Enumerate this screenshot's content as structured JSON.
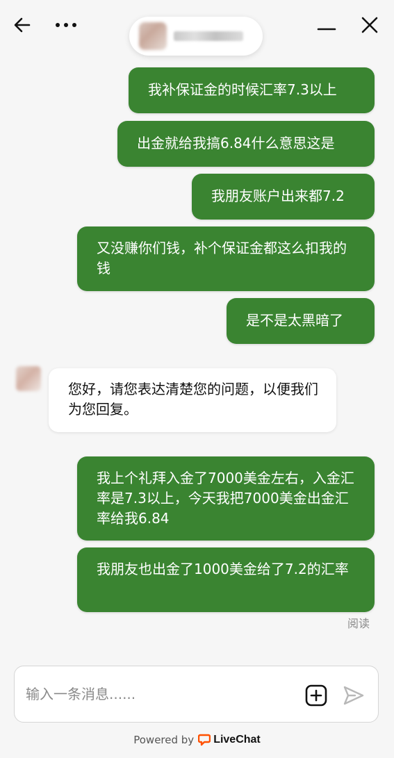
{
  "header": {
    "agent_name": ""
  },
  "messages": [
    {
      "id": "m1",
      "from": "visitor",
      "text": "我补保证金的时候汇率7.3以上"
    },
    {
      "id": "m2",
      "from": "visitor",
      "text": "出金就给我搞6.84什么意思这是"
    },
    {
      "id": "m3",
      "from": "visitor",
      "text": "我朋友账户出来都7.2"
    },
    {
      "id": "m4",
      "from": "visitor",
      "text": "又没赚你们钱，补个保证金都这么扣我的钱"
    },
    {
      "id": "m5",
      "from": "visitor",
      "text": "是不是太黑暗了"
    },
    {
      "id": "m6",
      "from": "agent",
      "text": "您好，请您表达清楚您的问题，以便我们为您回复。"
    },
    {
      "id": "m7",
      "from": "visitor",
      "text": "我上个礼拜入金了7000美金左右，入金汇率是7.3以上，今天我把7000美金出金汇率给我6.84"
    },
    {
      "id": "m8",
      "from": "visitor",
      "text": "我朋友也出金了1000美金给了7.2的汇率"
    }
  ],
  "read_status": "阅读",
  "composer": {
    "placeholder": "输入一条消息......"
  },
  "footer": {
    "powered_by": "Powered by",
    "brand": "LiveChat"
  },
  "colors": {
    "visitor_bubble": "#3a8431",
    "agent_bubble": "#ffffff",
    "background": "#f6f6f6",
    "brand_accent": "#ff5100"
  }
}
